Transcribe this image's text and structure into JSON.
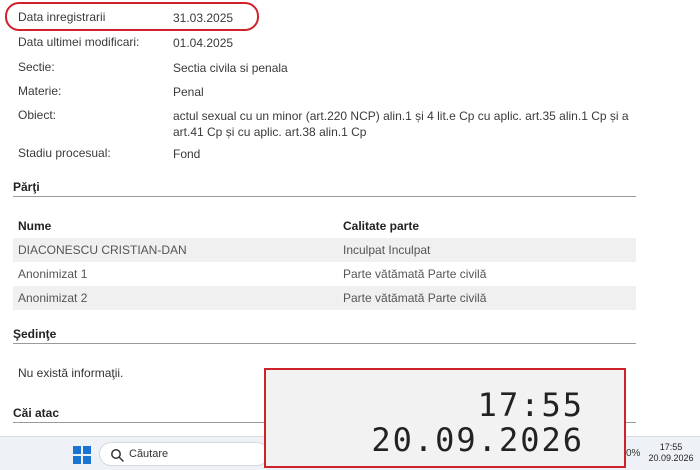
{
  "details": [
    {
      "label": "Data inregistrarii",
      "value": "31.03.2025"
    },
    {
      "label": "Data ultimei modificari:",
      "value": "01.04.2025"
    },
    {
      "label": "Sectie:",
      "value": "Sectia civila si penala"
    },
    {
      "label": "Materie:",
      "value": "Penal"
    },
    {
      "label": "Obiect:",
      "value": "actul sexual cu un minor (art.220 NCP) alin.1 și 4 lit.e Cp cu aplic. art.35 alin.1 Cp și a art.41 Cp și cu aplic. art.38 alin.1 Cp"
    },
    {
      "label": "Stadiu procesual:",
      "value": "Fond"
    }
  ],
  "parti": {
    "heading": "Părţi",
    "columns": [
      "Nume",
      "Calitate parte"
    ],
    "rows": [
      [
        "DIACONESCU CRISTIAN-DAN",
        "Inculpat Inculpat"
      ],
      [
        "Anonimizat 1",
        "Parte vătămată Parte civilă"
      ],
      [
        "Anonimizat 2",
        "Parte vătămată Parte civilă"
      ]
    ]
  },
  "sedinte": {
    "heading": "Şedinţe",
    "empty_text": "Nu există informaţii."
  },
  "cai_atac": {
    "heading": "Căi atac"
  },
  "taskbar": {
    "search_placeholder": "Căutare",
    "tray_percent": "0%",
    "time": "17:55",
    "date": "20.09.2026"
  },
  "overlay": {
    "time": "17:55",
    "date": "20.09.2026"
  },
  "colors": {
    "highlight": "#d0202a",
    "windows_blue": "#1a74d2",
    "row_alt": "#f0f0f0"
  }
}
